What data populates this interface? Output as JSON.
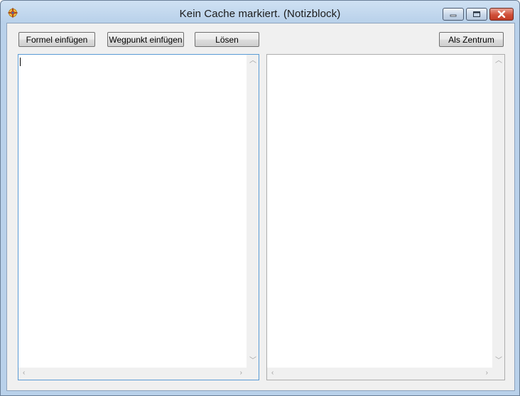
{
  "window": {
    "title": "Kein Cache markiert. (Notizblock)"
  },
  "toolbar": {
    "formel_label": "Formel einfügen",
    "wegpunkt_label": "Wegpunkt einfügen",
    "loesen_label": "Lösen",
    "zentrum_label": "Als Zentrum"
  },
  "editor": {
    "input_text": "",
    "output_text": ""
  },
  "icons": {
    "app": "app-compass-icon",
    "minimize": "minimize-icon",
    "maximize": "maximize-icon",
    "close": "close-icon",
    "scroll_up": "chevron-up-icon",
    "scroll_down": "chevron-down-icon",
    "scroll_left": "chevron-left-icon",
    "scroll_right": "chevron-right-icon"
  },
  "colors": {
    "titlebar": "#b9d1ea",
    "close_button": "#c13a25",
    "focus_border": "#5a9bd5"
  }
}
